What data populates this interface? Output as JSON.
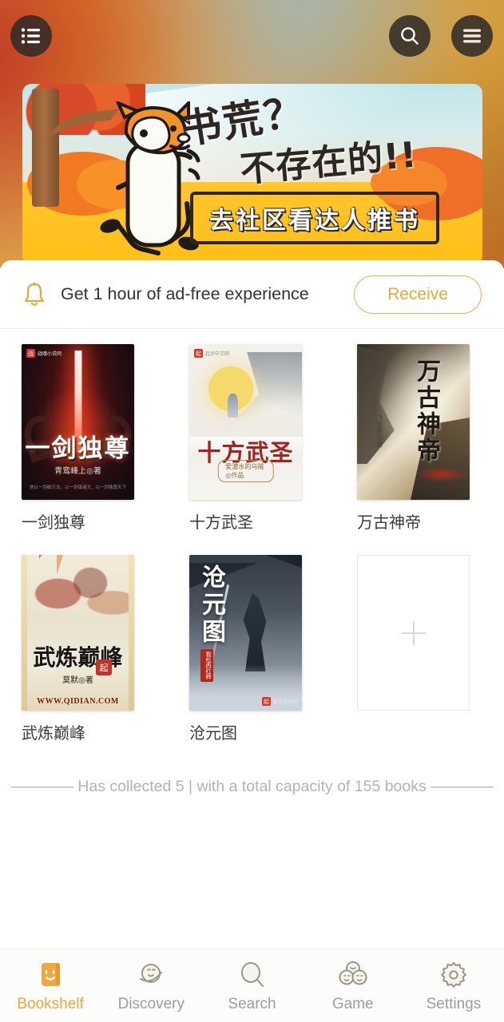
{
  "topbar": {
    "list_button": "list-view",
    "search_button": "search",
    "menu_button": "menu"
  },
  "banner": {
    "line1": "书荒？",
    "line2": "不存在的!!",
    "cta": "去社区看达人推书",
    "alt": "cartoon fox pointing at slogan"
  },
  "notice": {
    "icon": "bell-icon",
    "text": "Get 1 hour of ad-free experience",
    "button_label": "Receive",
    "accent_color": "#e5a93c"
  },
  "books": [
    {
      "title": "一剑独尊",
      "cover_title": "一剑独尊",
      "cover_author": "青鸾峰上◎著",
      "cover_sub": "他以一剑破万法，以一剑镇诸天，以一剑独尊天下",
      "cover_brand": "战",
      "cover_brand_text": "战魂小说网"
    },
    {
      "title": "十方武圣",
      "cover_title": "十方武圣",
      "cover_seal": "爱潜水的乌贼◎作品",
      "cover_brand": "起",
      "cover_brand_text": "起点中文网"
    },
    {
      "title": "万古神帝",
      "cover_title": "万古神帝",
      "cover_author": "飞天鱼◎著"
    },
    {
      "title": "武炼巅峰",
      "cover_title": "武炼巅峰",
      "cover_author": "莫默◎著",
      "cover_chop": "起",
      "cover_url": "WWW.QIDIAN.COM"
    },
    {
      "title": "沧元图",
      "cover_title": "沧元图",
      "cover_seal": "我吃西红柿",
      "cover_brand": "起",
      "cover_brand_text": "起点中文网"
    }
  ],
  "add_slot": {
    "icon": "plus-icon",
    "label": ""
  },
  "collected": "———— Has collected 5 | with a total capacity of 155 books ————",
  "tabbar": {
    "items": [
      {
        "label": "Bookshelf",
        "icon": "bookshelf-icon",
        "active": true
      },
      {
        "label": "Discovery",
        "icon": "planet-face-icon",
        "active": false
      },
      {
        "label": "Search",
        "icon": "magnifier-icon",
        "active": false
      },
      {
        "label": "Game",
        "icon": "three-faces-icon",
        "active": false
      },
      {
        "label": "Settings",
        "icon": "gear-icon",
        "active": false
      }
    ],
    "active_color": "#f0a63c",
    "inactive_color": "#9d9d9d"
  }
}
